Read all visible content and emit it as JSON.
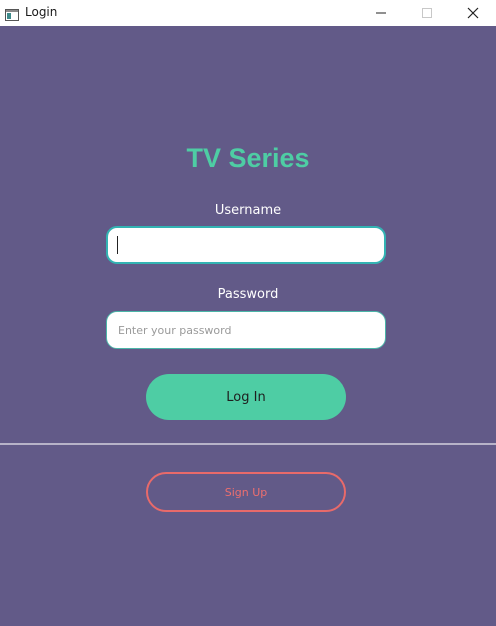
{
  "window": {
    "title": "Login",
    "controls": {
      "minimize": "minimize-icon",
      "maximize": "maximize-icon",
      "close": "close-icon"
    }
  },
  "app": {
    "title": "TV Series"
  },
  "form": {
    "username": {
      "label": "Username",
      "value": "",
      "placeholder": ""
    },
    "password": {
      "label": "Password",
      "value": "",
      "placeholder": "Enter your password"
    },
    "login_label": "Log In",
    "signup_label": "Sign Up"
  },
  "colors": {
    "background": "#625a88",
    "accent": "#4ecda4",
    "signup": "#ee6f6f",
    "input_focus_border": "#33b3b3"
  }
}
